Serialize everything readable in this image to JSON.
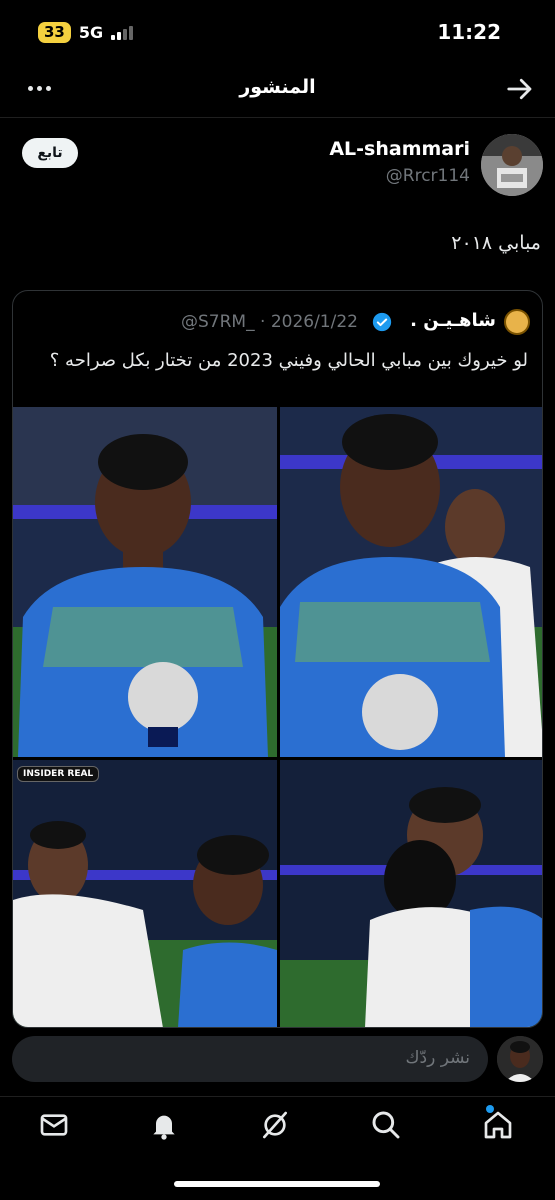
{
  "status_bar": {
    "battery": "33",
    "network": "5G",
    "time": "11:22"
  },
  "header": {
    "title": "المنشور"
  },
  "post": {
    "author_name": "AL-shammari",
    "author_handle": "@Rrcr114",
    "follow_label": "تابع",
    "text": "مبابي ٢٠١٨"
  },
  "quote": {
    "name": "شاهـيـن .",
    "handle": "@S7RM_",
    "date": "2026/1/22",
    "separator": "·",
    "text": "لو خيروك بين مبابي الحالي وفيني 2023  من تختار بكل صراحه ؟",
    "badge": "INSIDER REAL"
  },
  "reply": {
    "placeholder": "نشر ردّك"
  },
  "nav": [
    "mail-icon",
    "bell-icon",
    "grok-icon",
    "search-icon",
    "home-icon"
  ],
  "colors": {
    "accent": "#1d9bf0",
    "battery": "#f4d03f",
    "background": "#000000"
  }
}
